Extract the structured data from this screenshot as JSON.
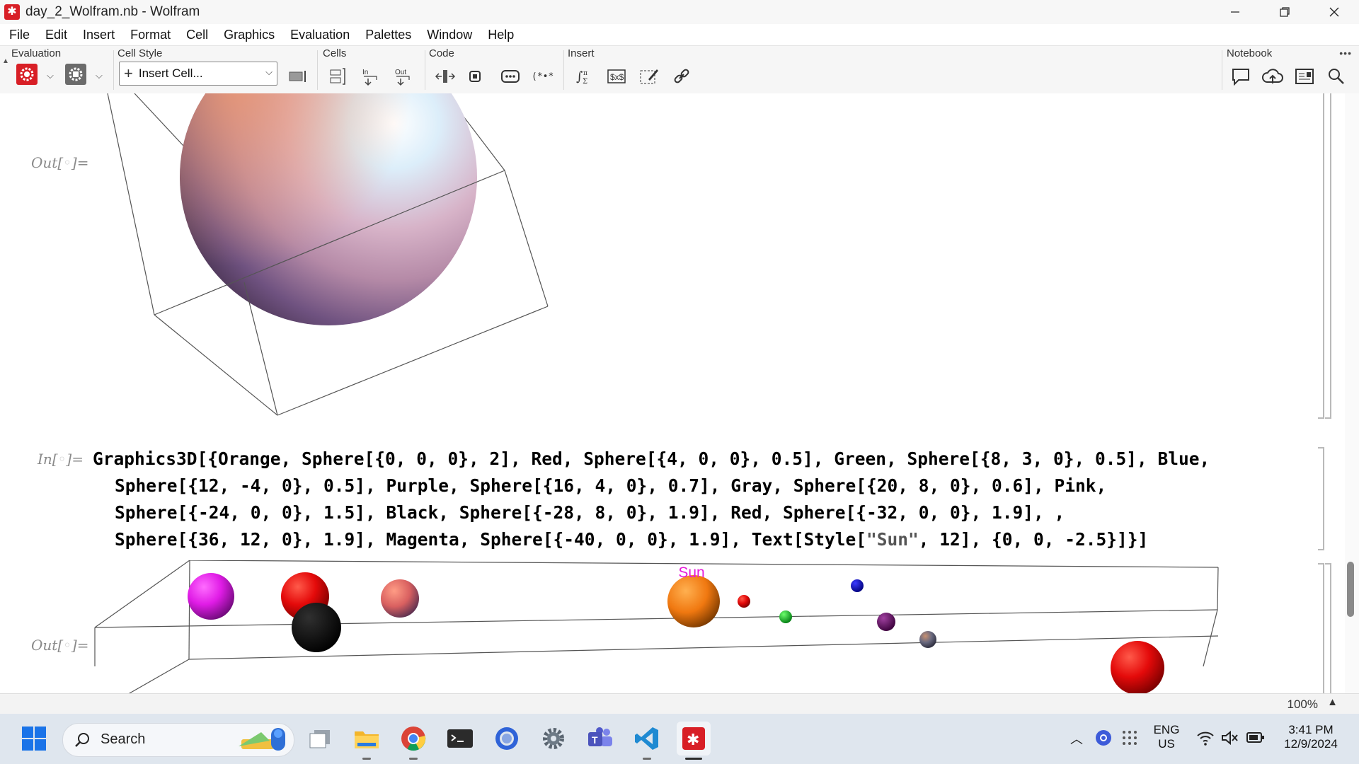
{
  "window": {
    "title": "day_2_Wolfram.nb - Wolfram",
    "controls": [
      "minimize",
      "restore",
      "close"
    ]
  },
  "menu": [
    "File",
    "Edit",
    "Insert",
    "Format",
    "Cell",
    "Graphics",
    "Evaluation",
    "Palettes",
    "Window",
    "Help"
  ],
  "toolbar": {
    "groups": {
      "evaluation": "Evaluation",
      "cell_style": "Cell Style",
      "cells": "Cells",
      "code": "Code",
      "insert": "Insert",
      "notebook": "Notebook"
    },
    "cell_style_value": "Insert Cell...",
    "in_label": "In",
    "out_label": "Out",
    "more": "•••"
  },
  "notebook": {
    "out_label": "Out[",
    "in_label": "In[",
    "label_close": "]=",
    "dot": "◦",
    "input_code": {
      "line1": "Graphics3D[{Orange, Sphere[{0, 0, 0}, 2], Red, Sphere[{4, 0, 0}, 0.5], Green, Sphere[{8, 3, 0}, 0.5], Blue,",
      "line2": "Sphere[{12, -4, 0}, 0.5], Purple, Sphere[{16, 4, 0}, 0.7], Gray, Sphere[{20, 8, 0}, 0.6], Pink,",
      "line3": "Sphere[{-24, 0, 0}, 1.5], Black, Sphere[{-28, 8, 0}, 1.9], Red, Sphere[{-32, 0, 0}, 1.9], ,",
      "line4_pre": "Sphere[{36, 12, 0}, 1.9], Magenta, Sphere[{-40, 0, 0}, 1.9], Text[Style[",
      "line4_str": "\"Sun\"",
      "line4_post": ", 12], {0, 0, -2.5}]}]"
    },
    "graphic_label": "Sun",
    "label_color": "#e619d9"
  },
  "status": {
    "zoom": "100%"
  },
  "taskbar": {
    "search_placeholder": "Search",
    "lang_line1": "ENG",
    "lang_line2": "US",
    "time": "3:41 PM",
    "date": "12/9/2024"
  }
}
